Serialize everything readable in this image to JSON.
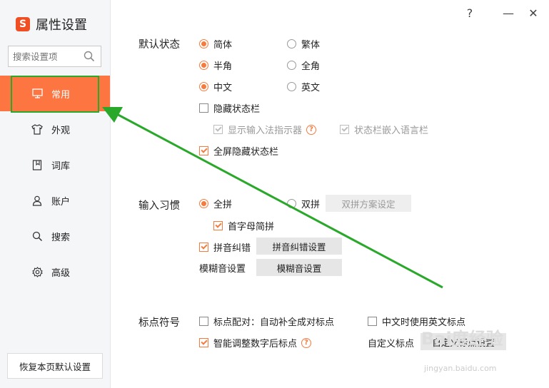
{
  "app": {
    "title": "属性设置",
    "logo_letter": "S"
  },
  "search": {
    "placeholder": "搜索设置项"
  },
  "sidebar": {
    "items": [
      {
        "label": "常用",
        "icon": "monitor-icon",
        "active": true
      },
      {
        "label": "外观",
        "icon": "tshirt-icon"
      },
      {
        "label": "词库",
        "icon": "book-icon"
      },
      {
        "label": "账户",
        "icon": "user-icon"
      },
      {
        "label": "搜索",
        "icon": "search-icon"
      },
      {
        "label": "高级",
        "icon": "gear-icon"
      }
    ],
    "reset_label": "恢复本页默认设置"
  },
  "window": {
    "help": "?",
    "minimize": "—",
    "close": "✕"
  },
  "default_state": {
    "label": "默认状态",
    "simplified": "简体",
    "traditional": "繁体",
    "half_width": "半角",
    "full_width": "全角",
    "chinese": "中文",
    "english": "英文",
    "hide_status_bar": "隐藏状态栏",
    "show_ime_indicator": "显示输入法指示器",
    "embed_language_bar": "状态栏嵌入语言栏",
    "fullscreen_hide_status_bar": "全屏隐藏状态栏"
  },
  "input_habit": {
    "label": "输入习惯",
    "full_pinyin": "全拼",
    "double_pinyin": "双拼",
    "double_pinyin_settings": "双拼方案设定",
    "initial_abbrev": "首字母简拼",
    "pinyin_correction": "拼音纠错",
    "pinyin_correction_settings": "拼音纠错设置",
    "fuzzy_label": "模糊音设置",
    "fuzzy_settings": "模糊音设置"
  },
  "punctuation": {
    "label": "标点符号",
    "auto_pair": "标点配对：自动补全成对标点",
    "english_punct_in_chinese": "中文时使用英文标点",
    "smart_number_punct": "智能调整数字后标点",
    "custom_label": "自定义标点",
    "custom_settings": "自定义标点设置"
  },
  "watermark": {
    "main": "Bai度经验",
    "sub": "jingyan.baidu.com"
  },
  "colors": {
    "accent": "#fd7540",
    "highlight": "#2aa82a"
  }
}
